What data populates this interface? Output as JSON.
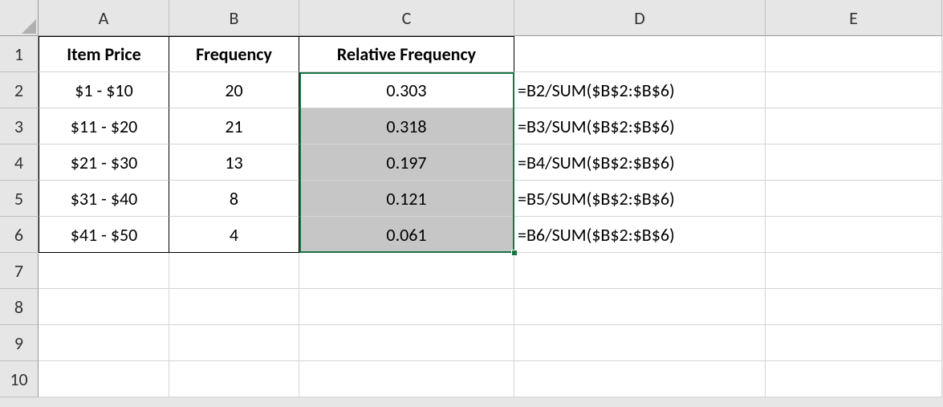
{
  "columns": [
    "A",
    "B",
    "C",
    "D",
    "E"
  ],
  "rows": [
    "1",
    "2",
    "3",
    "4",
    "5",
    "6",
    "7",
    "8",
    "9",
    "10"
  ],
  "headers": {
    "A": "Item Price",
    "B": "Frequency",
    "C": "Relative Frequency"
  },
  "data": [
    {
      "price": "$1 - $10",
      "freq": "20",
      "rel": "0.303",
      "formula": "=B2/SUM($B$2:$B$6)"
    },
    {
      "price": "$11 - $20",
      "freq": "21",
      "rel": "0.318",
      "formula": "=B3/SUM($B$2:$B$6)"
    },
    {
      "price": "$21 - $30",
      "freq": "13",
      "rel": "0.197",
      "formula": "=B4/SUM($B$2:$B$6)"
    },
    {
      "price": "$31 - $40",
      "freq": "8",
      "rel": "0.121",
      "formula": "=B5/SUM($B$2:$B$6)"
    },
    {
      "price": "$41 - $50",
      "freq": "4",
      "rel": "0.061",
      "formula": "=B6/SUM($B$2:$B$6)"
    }
  ],
  "selection": {
    "range": "C2:C6",
    "active": "C2"
  }
}
